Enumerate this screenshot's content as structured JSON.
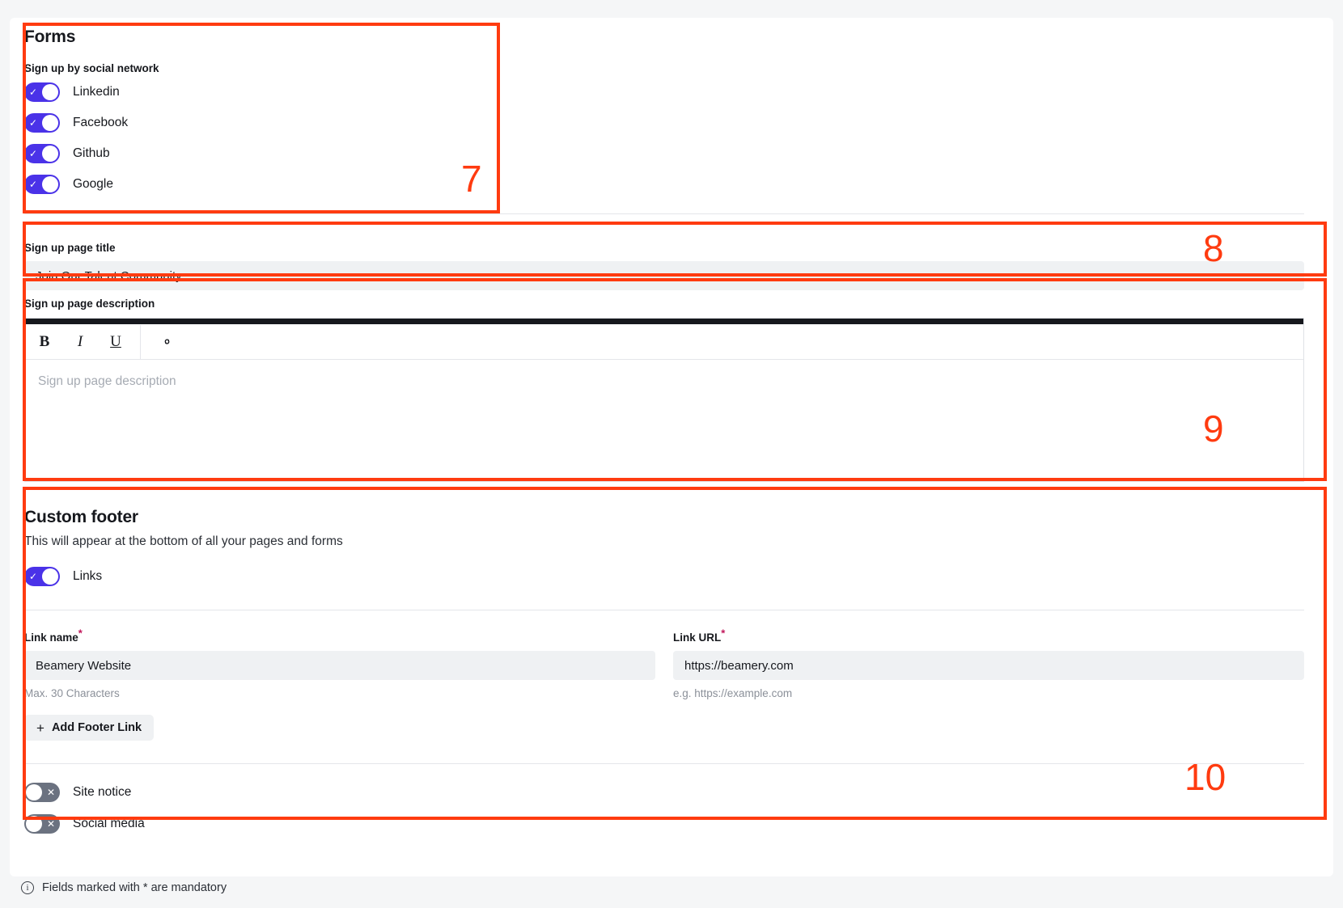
{
  "annotations": [
    {
      "number": "7"
    },
    {
      "number": "8"
    },
    {
      "number": "9"
    },
    {
      "number": "10"
    }
  ],
  "forms_section": {
    "title": "Forms",
    "social_label": "Sign up by social network",
    "social_toggles": [
      {
        "label": "Linkedin",
        "state": "on"
      },
      {
        "label": "Facebook",
        "state": "on"
      },
      {
        "label": "Github",
        "state": "on"
      },
      {
        "label": "Google",
        "state": "on"
      }
    ]
  },
  "signup_title_field": {
    "label": "Sign up page title",
    "value": "Join Our Talent Community"
  },
  "signup_description_field": {
    "label": "Sign up page description",
    "placeholder": "Sign up page description",
    "toolbar": {
      "bold": "B",
      "italic": "I",
      "underline": "U",
      "link_icon": "link-icon"
    }
  },
  "custom_footer": {
    "title": "Custom footer",
    "subtitle": "This will appear at the bottom of all your pages and forms",
    "links_toggle": {
      "label": "Links",
      "state": "on"
    },
    "link_name": {
      "label": "Link name",
      "required_mark": "*",
      "value": "Beamery Website",
      "helper": "Max. 30 Characters"
    },
    "link_url": {
      "label": "Link URL",
      "required_mark": "*",
      "value": "https://beamery.com",
      "helper": "e.g. https://example.com"
    },
    "add_link_button": {
      "label": "Add Footer Link",
      "icon": "plus-icon"
    },
    "extra_toggles": [
      {
        "label": "Site notice",
        "state": "off"
      },
      {
        "label": "Social media",
        "state": "off"
      }
    ]
  },
  "bottom_note": {
    "icon": "info-icon",
    "text": "Fields marked with * are mandatory"
  },
  "colors": {
    "annotation": "#ff3b10",
    "toggle_on": "#4a32e8",
    "toggle_off": "#6b7280",
    "required_star": "#c2185b",
    "input_bg": "#eff1f3"
  }
}
